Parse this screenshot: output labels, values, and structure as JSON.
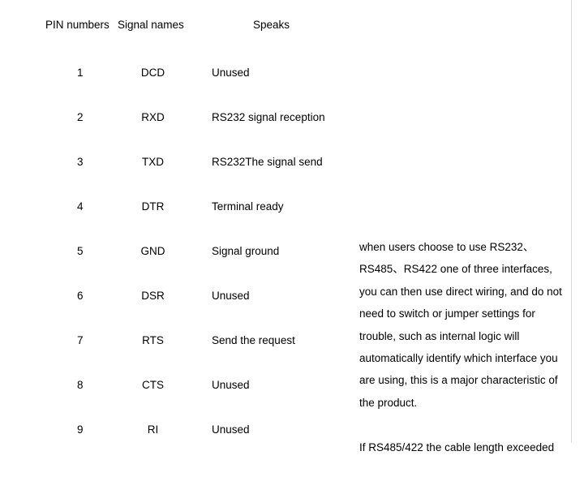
{
  "table": {
    "headers": {
      "pin": "PIN numbers",
      "signal": "Signal names",
      "speaks": "Speaks"
    },
    "rows": [
      {
        "pin": "1",
        "signal": "DCD",
        "speaks": "Unused"
      },
      {
        "pin": "2",
        "signal": "RXD",
        "speaks": "RS232 signal reception"
      },
      {
        "pin": "3",
        "signal": "TXD",
        "speaks": "RS232The signal send"
      },
      {
        "pin": "4",
        "signal": "DTR",
        "speaks": "Terminal ready"
      },
      {
        "pin": "5",
        "signal": "GND",
        "speaks": "Signal ground"
      },
      {
        "pin": "6",
        "signal": "DSR",
        "speaks": "Unused"
      },
      {
        "pin": "7",
        "signal": "RTS",
        "speaks": "Send the request"
      },
      {
        "pin": "8",
        "signal": "CTS",
        "speaks": "Unused"
      },
      {
        "pin": "9",
        "signal": "RI",
        "speaks": "Unused"
      }
    ]
  },
  "note": {
    "lines": [
      "when users choose to use RS232、",
      "RS485、RS422 one of three interfaces,",
      "you can then use direct wiring, and do not",
      "need to switch or jumper settings for",
      "trouble, such as internal logic will",
      "automatically identify which interface you",
      "are using, this is a major characteristic of",
      "the product."
    ],
    "trailing_line": "If RS485/422 the cable length exceeded"
  },
  "colors": {
    "text": "#000000",
    "background": "#ffffff",
    "divider": "#d9d9d9"
  }
}
